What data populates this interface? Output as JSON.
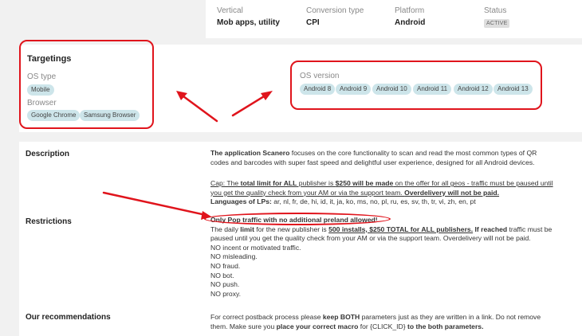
{
  "header": {
    "vertical_label": "Vertical",
    "vertical_value": "Mob apps, utility",
    "conversion_label": "Conversion type",
    "conversion_value": "CPI",
    "platform_label": "Platform",
    "platform_value": "Android",
    "status_label": "Status",
    "status_value": "ACTIVE"
  },
  "targetings": {
    "title": "Targetings",
    "os_type_label": "OS type",
    "os_type_chips": [
      "Mobile"
    ],
    "browser_label": "Browser",
    "browser_chips": [
      "Google Chrome",
      "Samsung Browser"
    ],
    "os_version_label": "OS version",
    "os_version_chips": [
      "Android 8",
      "Android 9",
      "Android 10",
      "Android 11",
      "Android 12",
      "Android 13"
    ]
  },
  "details": {
    "description_label": "Description",
    "desc_p1_bold": "The application Scanero",
    "desc_p1_rest": " focuses on the core functionality to scan and read the most common types of QR",
    "desc_p1_line2": "codes and barcodes with super fast speed and delightful user experience, designed for all Android devices.",
    "cap_a": "Cap: The ",
    "cap_b": "total limit for ALL",
    "cap_c": " publisher is ",
    "cap_d": "$250 will be made",
    "cap_e": " on the offer for all geos  - traffic must be paused until",
    "cap_line2a": "you get the quality check from your AM or via the support team. ",
    "cap_line2b": "Overdelivery will not be paid.",
    "lps_label": "Languages of LPs:",
    "lps_value": " ar, nl, fr, de, hi, id, it, ja, ko, ms, no, pl, ru, es, sv, th, tr, vi, zh, en, pt",
    "restrictions_label": "Restrictions",
    "restr_line1": "Only Pop traffic with no additional preland allowed!",
    "restr_l2a": "The daily ",
    "restr_l2b": "limit",
    "restr_l2c": " for the new publisher is ",
    "restr_l2d": "500 installs, $250 TOTAL for ALL publishers.",
    "restr_l2e": " If reached",
    "restr_l2f": " traffic must be",
    "restr_l3": "paused until you get the quality check from your AM or via the support team. Overdelivery will not be paid.",
    "restr_items": [
      "NO incent or motivated traffic.",
      "NO misleading.",
      "NO fraud.",
      "NO bot.",
      "NO push.",
      "NO proxy."
    ],
    "recommendations_label": "Our recommendations",
    "rec_l1a": "For correct postback process please ",
    "rec_l1b": "keep BOTH",
    "rec_l1c": " parameters just as they are written in a link. Do not remove",
    "rec_l2a": "them. Make sure you ",
    "rec_l2b": "place your correct macro",
    "rec_l2c": " for {CLICK_ID} ",
    "rec_l2d": "to the both parameters."
  },
  "colors": {
    "annotation_red": "#e0141c",
    "chip_bg": "#cde5ea",
    "page_bg": "#f1f1f1"
  }
}
